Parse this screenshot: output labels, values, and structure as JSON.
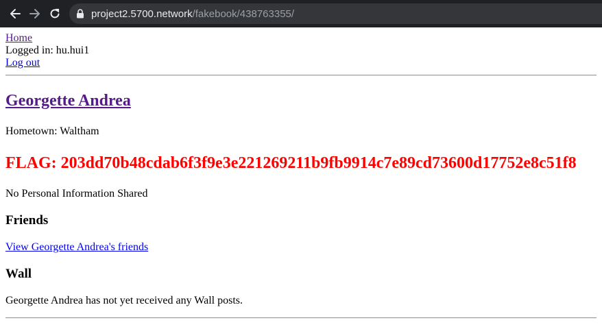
{
  "browser": {
    "url_host": "project2.5700.network",
    "url_path": "/fakebook/438763355/"
  },
  "nav": {
    "home_label": "Home",
    "logged_in_text": "Logged in: hu.hui1",
    "logout_label": "Log out"
  },
  "profile": {
    "name": "Georgette Andrea",
    "hometown": "Hometown: Waltham",
    "flag": "FLAG: 203dd70b48cdab6f3f9e3e221269211b9fb9914c7e89cd73600d17752e8c51f8",
    "personal_info": "No Personal Information Shared"
  },
  "friends": {
    "heading": "Friends",
    "link_label": "View Georgette Andrea's friends"
  },
  "wall": {
    "heading": "Wall",
    "message": "Georgette Andrea has not yet received any Wall posts."
  },
  "colors": {
    "flag": "#ff0000",
    "link": "#0000ee",
    "visited_link": "#551a8b",
    "toolbar": "#202124"
  }
}
